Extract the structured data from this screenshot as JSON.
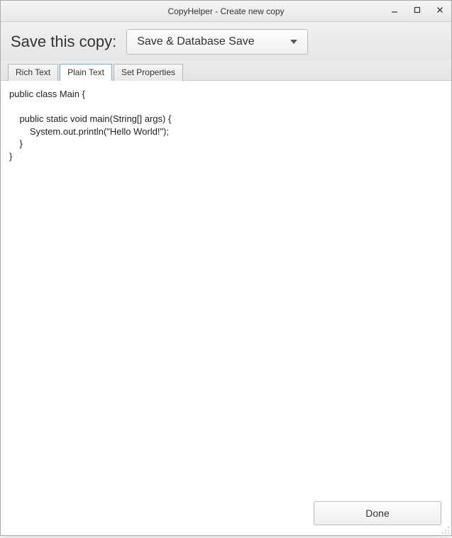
{
  "window": {
    "title": "CopyHelper - Create new copy"
  },
  "header": {
    "label": "Save this copy:",
    "dropdown_selected": "Save & Database Save"
  },
  "tabs": {
    "items": [
      {
        "label": "Rich Text"
      },
      {
        "label": "Plain Text"
      },
      {
        "label": "Set Properties"
      }
    ],
    "active_index": 1
  },
  "editor": {
    "text": "public class Main {\n\n    public static void main(String[] args) {\n        System.out.println(\"Hello World!\");\n    }\n}"
  },
  "footer": {
    "done_label": "Done"
  }
}
